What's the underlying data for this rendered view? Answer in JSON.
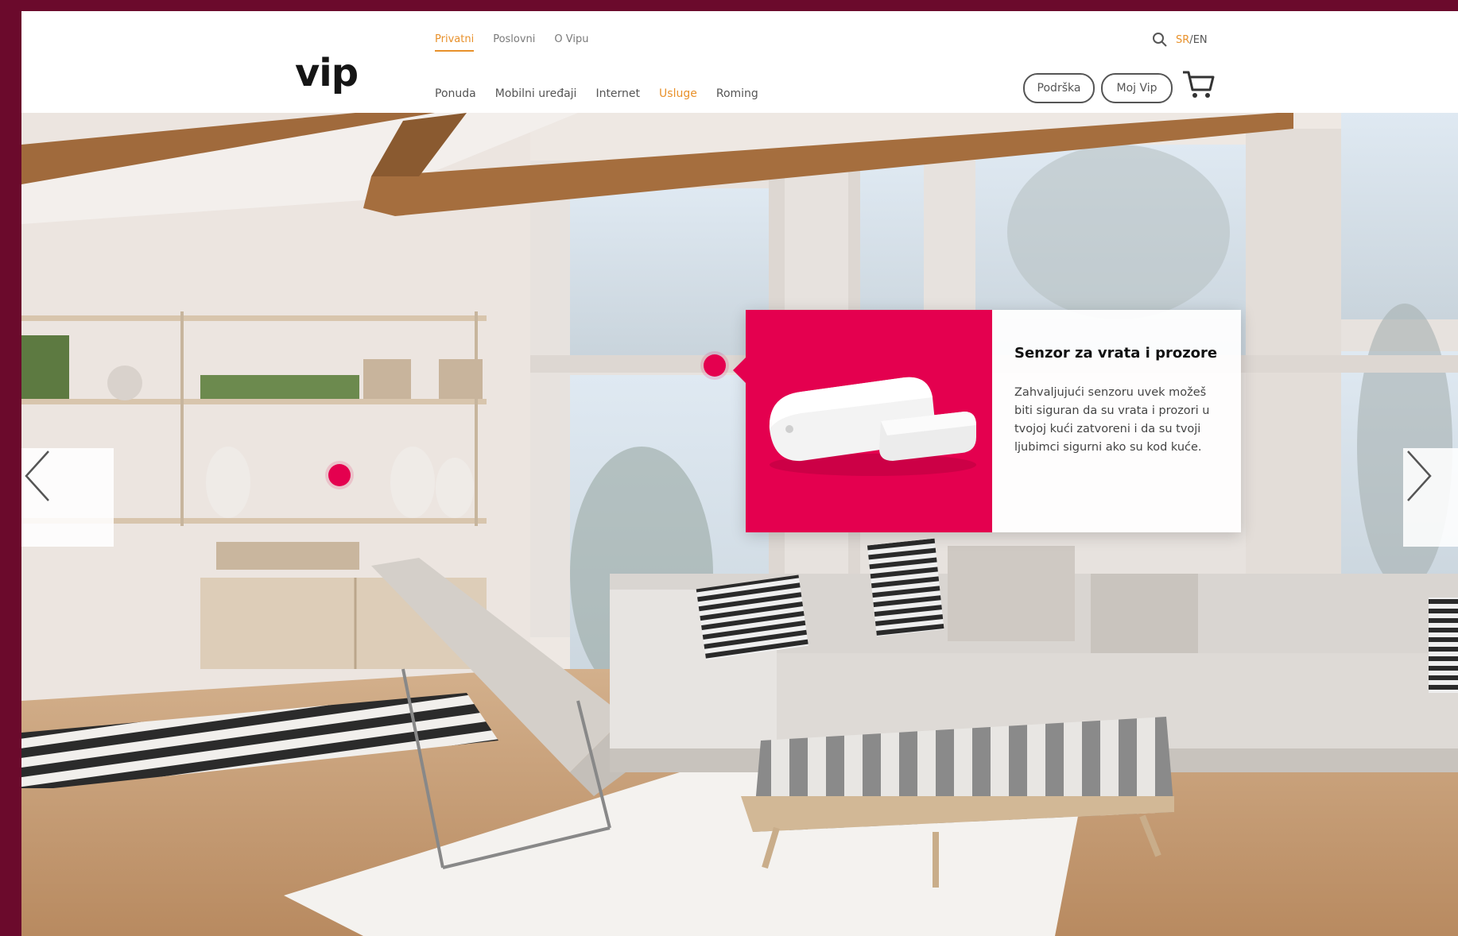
{
  "header": {
    "logo": "vip",
    "top_nav": [
      {
        "label": "Privatni",
        "active": true
      },
      {
        "label": "Poslovni",
        "active": false
      },
      {
        "label": "O Vipu",
        "active": false
      }
    ],
    "main_nav": [
      {
        "label": "Ponuda",
        "active": false
      },
      {
        "label": "Mobilni uređaji",
        "active": false
      },
      {
        "label": "Internet",
        "active": false
      },
      {
        "label": "Usluge",
        "active": true
      },
      {
        "label": "Roming",
        "active": false
      }
    ],
    "lang_active": "SR",
    "lang_sep": "/",
    "lang_other": "EN",
    "support_label": "Podrška",
    "myvip_label": "Moj Vip",
    "icons": {
      "search": "search-icon",
      "cart": "cart-icon"
    }
  },
  "hero": {
    "card": {
      "title": "Senzor za vrata i prozore",
      "body": "Zahvaljujući senzoru uvek možeš biti siguran da su vrata i prozori u tvojoj kući zatvoreni i da su tvoji ljubimci sigurni ako su kod kuće."
    }
  },
  "colors": {
    "accent_pink": "#e4004f",
    "nav_active_orange": "#e8912b",
    "frame_background": "#6b0a2c"
  }
}
